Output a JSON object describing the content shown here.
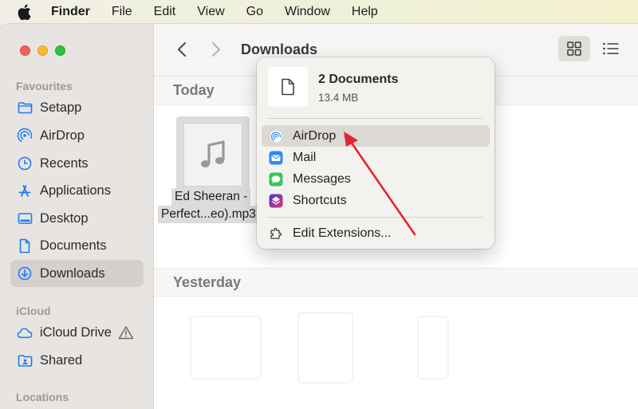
{
  "menubar": {
    "app_name": "Finder",
    "items": [
      "File",
      "Edit",
      "View",
      "Go",
      "Window",
      "Help"
    ]
  },
  "sidebar": {
    "favourites_label": "Favourites",
    "favourites": [
      {
        "label": "Setapp",
        "icon": "folder-icon"
      },
      {
        "label": "AirDrop",
        "icon": "airdrop-icon"
      },
      {
        "label": "Recents",
        "icon": "clock-icon"
      },
      {
        "label": "Applications",
        "icon": "applications-icon"
      },
      {
        "label": "Desktop",
        "icon": "desktop-icon"
      },
      {
        "label": "Documents",
        "icon": "document-icon"
      },
      {
        "label": "Downloads",
        "icon": "download-icon",
        "selected": true
      }
    ],
    "icloud_label": "iCloud",
    "icloud": [
      {
        "label": "iCloud Drive",
        "icon": "cloud-icon",
        "warning": true
      },
      {
        "label": "Shared",
        "icon": "shared-folder-icon"
      }
    ],
    "locations_label": "Locations"
  },
  "toolbar": {
    "title": "Downloads"
  },
  "content": {
    "groups": [
      "Today",
      "Yesterday"
    ],
    "file": {
      "name_line1": "Ed Sheeran -",
      "name_line2": "Perfect...eo).mp3"
    }
  },
  "share_popover": {
    "title": "2 Documents",
    "size": "13.4 MB",
    "items": [
      {
        "label": "AirDrop",
        "icon": "airdrop-icon",
        "highlighted": true
      },
      {
        "label": "Mail",
        "icon": "mail-icon"
      },
      {
        "label": "Messages",
        "icon": "messages-icon"
      },
      {
        "label": "Shortcuts",
        "icon": "shortcuts-icon"
      }
    ],
    "extensions_label": "Edit Extensions..."
  },
  "colors": {
    "accent_blue": "#1a7cf5",
    "annotation_red": "#e3262e",
    "selection": "#d3d0cd"
  }
}
